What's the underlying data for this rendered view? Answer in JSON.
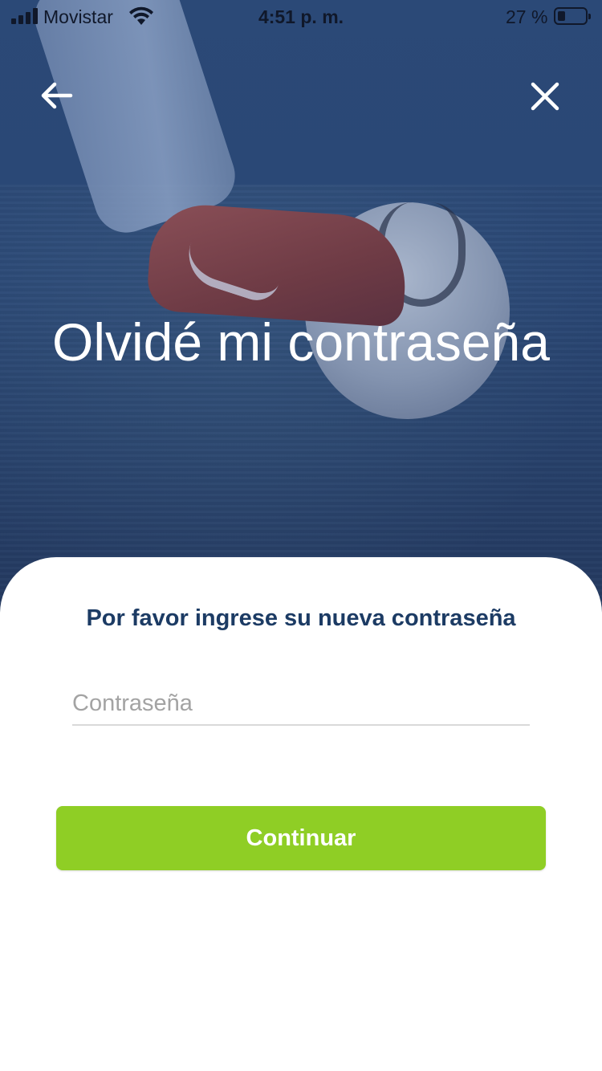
{
  "status_bar": {
    "carrier": "Movistar",
    "time": "4:51 p. m.",
    "battery_percent": "27 %",
    "battery_level": 0.27
  },
  "nav": {
    "back_icon": "arrow-left-icon",
    "close_icon": "close-icon"
  },
  "hero": {
    "title": "Olvidé mi contraseña"
  },
  "form": {
    "subtitle": "Por favor ingrese su nueva contraseña",
    "password_placeholder": "Contraseña",
    "password_value": "",
    "continue_label": "Continuar"
  },
  "colors": {
    "hero_overlay": "#2b4977",
    "title_text": "#1c3b64",
    "button": "#8fce25",
    "button_text": "#ffffff",
    "placeholder": "#a3a3a3"
  }
}
